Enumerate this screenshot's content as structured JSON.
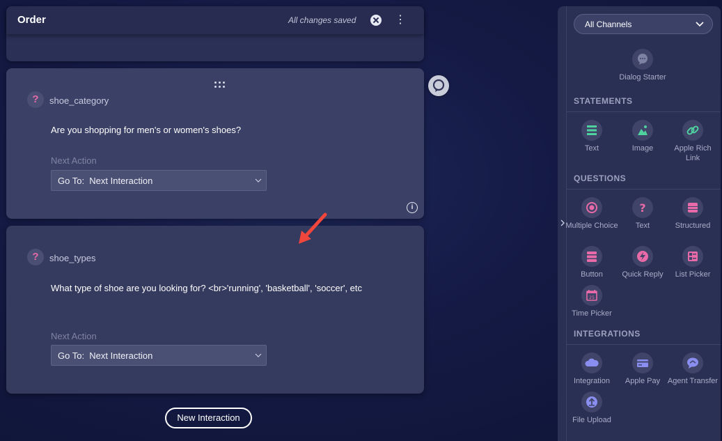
{
  "header": {
    "title": "Order",
    "status": "All changes saved",
    "more_glyph": "⋮"
  },
  "interactions": [
    {
      "name": "shoe_category",
      "question": "Are you shopping for men's or women's shoes?",
      "next_action_label": "Next Action",
      "next_action_value": "Go To:  Next Interaction"
    },
    {
      "name": "shoe_types",
      "question": "What type of shoe are you looking for? <br>'running', 'basketball', 'soccer', etc",
      "next_action_label": "Next Action",
      "next_action_value": "Go To:  Next Interaction"
    }
  ],
  "q_icon_glyph": "?",
  "info_glyph": "i",
  "new_interaction_label": "New Interaction",
  "panel": {
    "channel_select": "All Channels",
    "dialog_starter": "Dialog Starter",
    "sections": {
      "statements": "STATEMENTS",
      "questions": "QUESTIONS",
      "integrations": "INTEGRATIONS"
    },
    "statements": [
      "Text",
      "Image",
      "Apple Rich Link"
    ],
    "questions": [
      "Multiple Choice",
      "Text",
      "Structured",
      "Button",
      "Quick Reply",
      "List Picker",
      "Time Picker"
    ],
    "integrations": [
      "Integration",
      "Apple Pay",
      "Agent Transfer",
      "File Upload"
    ],
    "time_picker_day": "25"
  },
  "colors": {
    "statement_icon": "#4fd2a0",
    "question_icon": "#e86aa8",
    "integration_icon": "#8a8ef0",
    "arrow": "#f0463c"
  }
}
